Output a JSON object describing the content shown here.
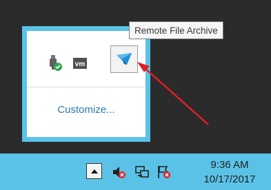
{
  "tooltip": {
    "text": "Remote File Archive"
  },
  "tray_popup": {
    "icons": [
      "usb-safely-remove-icon",
      "vmware-tools-icon",
      "remote-file-archive-icon"
    ],
    "customize_label": "Customize..."
  },
  "taskbar": {
    "icons": [
      "show-hidden-icons-chevron",
      "volume-muted-icon",
      "network-icon",
      "action-center-flag-icon"
    ],
    "clock": {
      "time": "9:36 AM",
      "date": "10/17/2017"
    }
  },
  "colors": {
    "accent": "#5bc2e7",
    "background": "#2b2b2b",
    "link": "#2a7ab0",
    "arrow": "#e31e24"
  }
}
